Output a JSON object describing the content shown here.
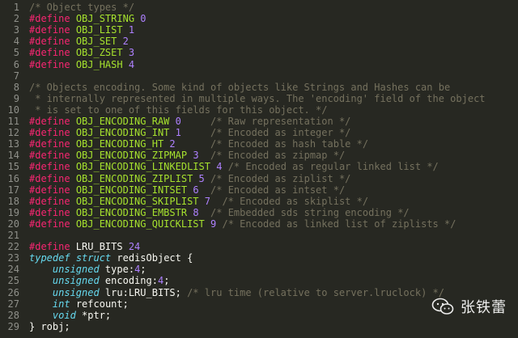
{
  "colors": {
    "background": "#272822",
    "line_number": "#8f908a",
    "keyword": "#f92672",
    "macro": "#a6e22e",
    "number": "#ae81ff",
    "comment": "#75715e",
    "type": "#66d9ef",
    "text": "#f8f8f2"
  },
  "editor": {
    "lines": [
      {
        "n": "1",
        "tokens": [
          [
            "cm",
            "/* Object types */"
          ]
        ]
      },
      {
        "n": "2",
        "tokens": [
          [
            "kw",
            "#define"
          ],
          [
            "tx",
            " "
          ],
          [
            "macro",
            "OBJ_STRING"
          ],
          [
            "tx",
            " "
          ],
          [
            "num",
            "0"
          ]
        ]
      },
      {
        "n": "3",
        "tokens": [
          [
            "kw",
            "#define"
          ],
          [
            "tx",
            " "
          ],
          [
            "macro",
            "OBJ_LIST"
          ],
          [
            "tx",
            " "
          ],
          [
            "num",
            "1"
          ]
        ]
      },
      {
        "n": "4",
        "tokens": [
          [
            "kw",
            "#define"
          ],
          [
            "tx",
            " "
          ],
          [
            "macro",
            "OBJ_SET"
          ],
          [
            "tx",
            " "
          ],
          [
            "num",
            "2"
          ]
        ]
      },
      {
        "n": "5",
        "tokens": [
          [
            "kw",
            "#define"
          ],
          [
            "tx",
            " "
          ],
          [
            "macro",
            "OBJ_ZSET"
          ],
          [
            "tx",
            " "
          ],
          [
            "num",
            "3"
          ]
        ]
      },
      {
        "n": "6",
        "tokens": [
          [
            "kw",
            "#define"
          ],
          [
            "tx",
            " "
          ],
          [
            "macro",
            "OBJ_HASH"
          ],
          [
            "tx",
            " "
          ],
          [
            "num",
            "4"
          ]
        ]
      },
      {
        "n": "7",
        "tokens": []
      },
      {
        "n": "8",
        "tokens": [
          [
            "cm",
            "/* Objects encoding. Some kind of objects like Strings and Hashes can be"
          ]
        ]
      },
      {
        "n": "9",
        "tokens": [
          [
            "cm",
            " * internally represented in multiple ways. The 'encoding' field of the object"
          ]
        ]
      },
      {
        "n": "10",
        "tokens": [
          [
            "cm",
            " * is set to one of this fields for this object. */"
          ]
        ]
      },
      {
        "n": "11",
        "tokens": [
          [
            "kw",
            "#define"
          ],
          [
            "tx",
            " "
          ],
          [
            "macro",
            "OBJ_ENCODING_RAW"
          ],
          [
            "tx",
            " "
          ],
          [
            "num",
            "0"
          ],
          [
            "tx",
            "     "
          ],
          [
            "cm",
            "/* Raw representation */"
          ]
        ]
      },
      {
        "n": "12",
        "tokens": [
          [
            "kw",
            "#define"
          ],
          [
            "tx",
            " "
          ],
          [
            "macro",
            "OBJ_ENCODING_INT"
          ],
          [
            "tx",
            " "
          ],
          [
            "num",
            "1"
          ],
          [
            "tx",
            "     "
          ],
          [
            "cm",
            "/* Encoded as integer */"
          ]
        ]
      },
      {
        "n": "13",
        "tokens": [
          [
            "kw",
            "#define"
          ],
          [
            "tx",
            " "
          ],
          [
            "macro",
            "OBJ_ENCODING_HT"
          ],
          [
            "tx",
            " "
          ],
          [
            "num",
            "2"
          ],
          [
            "tx",
            "      "
          ],
          [
            "cm",
            "/* Encoded as hash table */"
          ]
        ]
      },
      {
        "n": "14",
        "tokens": [
          [
            "kw",
            "#define"
          ],
          [
            "tx",
            " "
          ],
          [
            "macro",
            "OBJ_ENCODING_ZIPMAP"
          ],
          [
            "tx",
            " "
          ],
          [
            "num",
            "3"
          ],
          [
            "tx",
            "  "
          ],
          [
            "cm",
            "/* Encoded as zipmap */"
          ]
        ]
      },
      {
        "n": "15",
        "tokens": [
          [
            "kw",
            "#define"
          ],
          [
            "tx",
            " "
          ],
          [
            "macro",
            "OBJ_ENCODING_LINKEDLIST"
          ],
          [
            "tx",
            " "
          ],
          [
            "num",
            "4"
          ],
          [
            "tx",
            " "
          ],
          [
            "cm",
            "/* Encoded as regular linked list */"
          ]
        ]
      },
      {
        "n": "16",
        "tokens": [
          [
            "kw",
            "#define"
          ],
          [
            "tx",
            " "
          ],
          [
            "macro",
            "OBJ_ENCODING_ZIPLIST"
          ],
          [
            "tx",
            " "
          ],
          [
            "num",
            "5"
          ],
          [
            "tx",
            " "
          ],
          [
            "cm",
            "/* Encoded as ziplist */"
          ]
        ]
      },
      {
        "n": "17",
        "tokens": [
          [
            "kw",
            "#define"
          ],
          [
            "tx",
            " "
          ],
          [
            "macro",
            "OBJ_ENCODING_INTSET"
          ],
          [
            "tx",
            " "
          ],
          [
            "num",
            "6"
          ],
          [
            "tx",
            "  "
          ],
          [
            "cm",
            "/* Encoded as intset */"
          ]
        ]
      },
      {
        "n": "18",
        "tokens": [
          [
            "kw",
            "#define"
          ],
          [
            "tx",
            " "
          ],
          [
            "macro",
            "OBJ_ENCODING_SKIPLIST"
          ],
          [
            "tx",
            " "
          ],
          [
            "num",
            "7"
          ],
          [
            "tx",
            "  "
          ],
          [
            "cm",
            "/* Encoded as skiplist */"
          ]
        ]
      },
      {
        "n": "19",
        "tokens": [
          [
            "kw",
            "#define"
          ],
          [
            "tx",
            " "
          ],
          [
            "macro",
            "OBJ_ENCODING_EMBSTR"
          ],
          [
            "tx",
            " "
          ],
          [
            "num",
            "8"
          ],
          [
            "tx",
            "  "
          ],
          [
            "cm",
            "/* Embedded sds string encoding */"
          ]
        ]
      },
      {
        "n": "20",
        "tokens": [
          [
            "kw",
            "#define"
          ],
          [
            "tx",
            " "
          ],
          [
            "macro",
            "OBJ_ENCODING_QUICKLIST"
          ],
          [
            "tx",
            " "
          ],
          [
            "num",
            "9"
          ],
          [
            "tx",
            " "
          ],
          [
            "cm",
            "/* Encoded as linked list of ziplists */"
          ]
        ]
      },
      {
        "n": "21",
        "tokens": []
      },
      {
        "n": "22",
        "tokens": [
          [
            "kw",
            "#define"
          ],
          [
            "tx",
            " LRU_BITS "
          ],
          [
            "num",
            "24"
          ]
        ]
      },
      {
        "n": "23",
        "tokens": [
          [
            "type",
            "typedef"
          ],
          [
            "tx",
            " "
          ],
          [
            "type",
            "struct"
          ],
          [
            "tx",
            " redisObject {"
          ]
        ]
      },
      {
        "n": "24",
        "tokens": [
          [
            "tx",
            "    "
          ],
          [
            "type",
            "unsigned"
          ],
          [
            "tx",
            " type:"
          ],
          [
            "num",
            "4"
          ],
          [
            "tx",
            ";"
          ]
        ]
      },
      {
        "n": "25",
        "tokens": [
          [
            "tx",
            "    "
          ],
          [
            "type",
            "unsigned"
          ],
          [
            "tx",
            " encoding:"
          ],
          [
            "num",
            "4"
          ],
          [
            "tx",
            ";"
          ]
        ]
      },
      {
        "n": "26",
        "tokens": [
          [
            "tx",
            "    "
          ],
          [
            "type",
            "unsigned"
          ],
          [
            "tx",
            " lru:LRU_BITS; "
          ],
          [
            "cm",
            "/* lru time (relative to server.lruclock) */"
          ]
        ]
      },
      {
        "n": "27",
        "tokens": [
          [
            "tx",
            "    "
          ],
          [
            "type",
            "int"
          ],
          [
            "tx",
            " refcount;"
          ]
        ]
      },
      {
        "n": "28",
        "tokens": [
          [
            "tx",
            "    "
          ],
          [
            "type",
            "void"
          ],
          [
            "tx",
            " *ptr;"
          ]
        ]
      },
      {
        "n": "29",
        "tokens": [
          [
            "tx",
            "} robj;"
          ]
        ]
      }
    ]
  },
  "watermark": {
    "icon": "wechat-icon",
    "text": "张铁蕾"
  }
}
